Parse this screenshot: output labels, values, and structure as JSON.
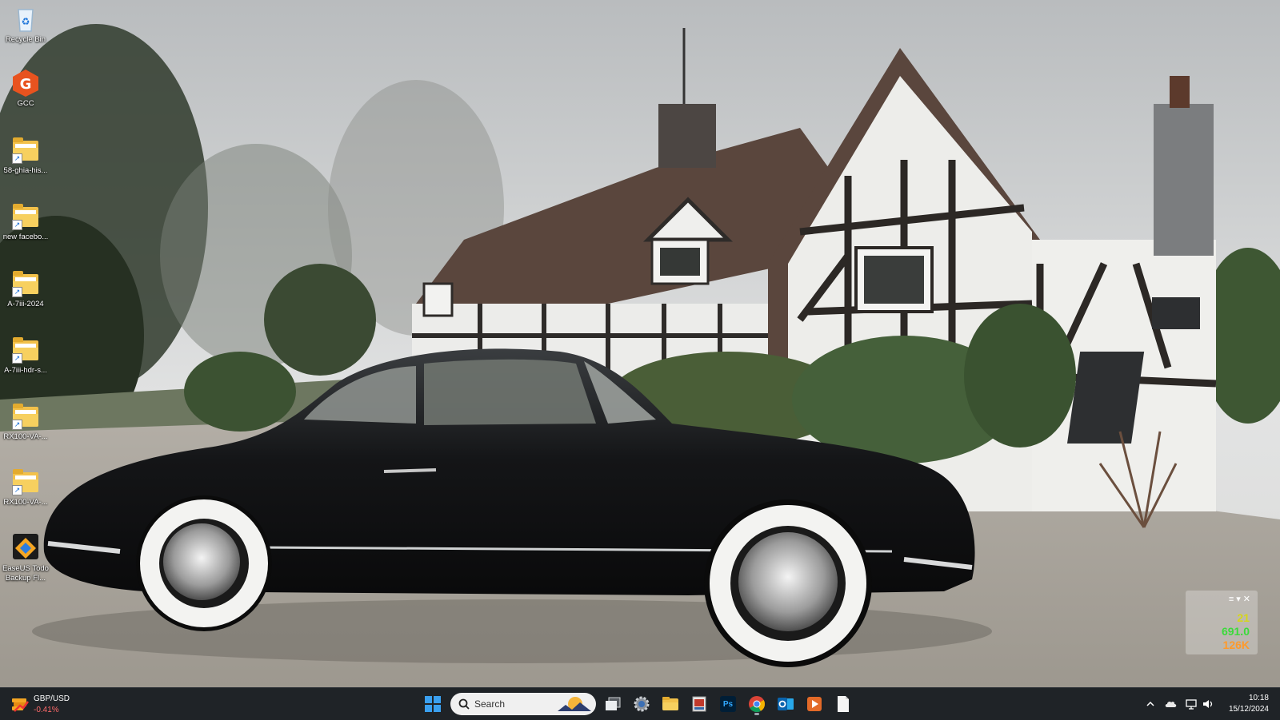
{
  "desktop": {
    "icons": [
      {
        "name": "recycle-bin",
        "label": "Recycle Bin"
      },
      {
        "name": "gcc",
        "label": "GCC"
      },
      {
        "name": "folder-1",
        "label": "58-ghia-his..."
      },
      {
        "name": "folder-2",
        "label": "new facebo..."
      },
      {
        "name": "folder-3",
        "label": "A-7iii-2024"
      },
      {
        "name": "folder-4",
        "label": "A-7iii-hdr-s..."
      },
      {
        "name": "folder-5",
        "label": "RX100-VA-..."
      },
      {
        "name": "folder-6",
        "label": "RX100-VA-..."
      },
      {
        "name": "easeus",
        "label": "EaseUS Todo Backup Fl..."
      }
    ]
  },
  "perf_widget": {
    "controls": "≡▾✕",
    "row1": "21",
    "row2": "691.0",
    "row3": "126K",
    "colors": {
      "row1": "#d6d61a",
      "row2": "#3adb3a",
      "row3": "#ff9a2a"
    }
  },
  "taskbar": {
    "news": {
      "title": "GBP/USD",
      "change": "-0.41%"
    },
    "search_placeholder": "Search",
    "apps": [
      "start-icon",
      "task-view-icon",
      "settings-icon",
      "file-explorer-icon",
      "image-viewer-icon",
      "photoshop-icon",
      "chrome-icon",
      "outlook-icon",
      "media-player-icon",
      "notepad-icon"
    ],
    "photoshop_label": "Ps",
    "clock": {
      "time": "10:18",
      "date": "15/12/2024"
    }
  },
  "colors": {
    "taskbar": "#1f2327",
    "accent": "#0078d4"
  }
}
